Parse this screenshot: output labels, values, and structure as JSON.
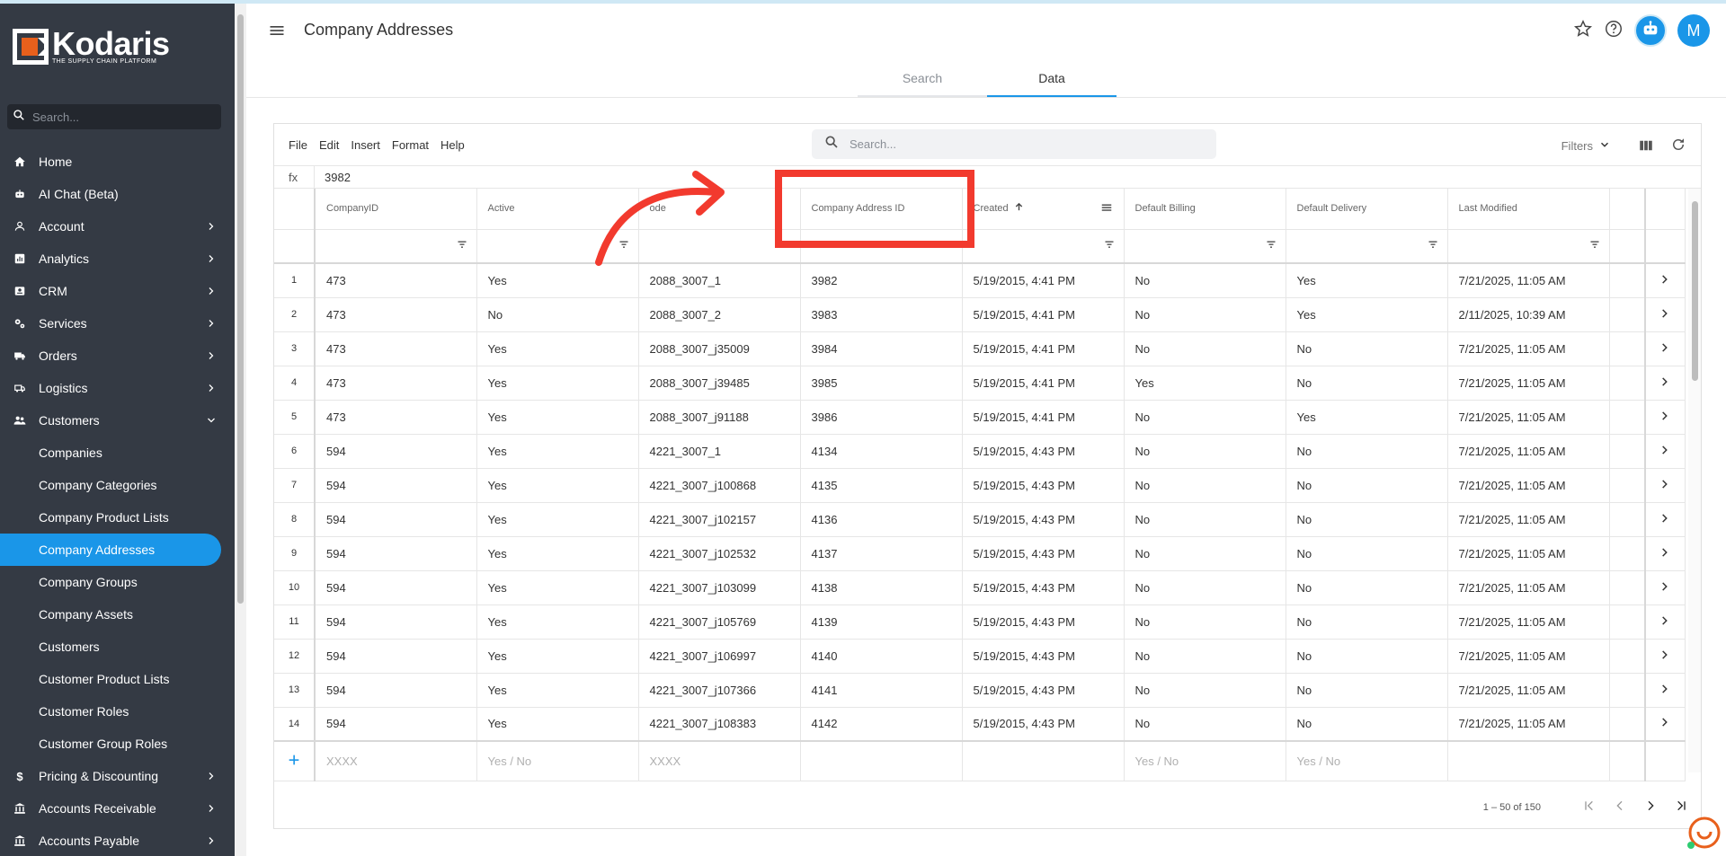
{
  "app": {
    "logo_name": "Kodaris",
    "logo_tagline": "THE SUPPLY CHAIN PLATFORM"
  },
  "sidebar": {
    "search_placeholder": "Search...",
    "items": [
      {
        "label": "Home",
        "icon": "home-icon",
        "expandable": false,
        "sub": false
      },
      {
        "label": "AI Chat (Beta)",
        "icon": "robot-icon",
        "expandable": false,
        "sub": false
      },
      {
        "label": "Account",
        "icon": "person-icon",
        "expandable": true,
        "sub": false
      },
      {
        "label": "Analytics",
        "icon": "chart-icon",
        "expandable": true,
        "sub": false
      },
      {
        "label": "CRM",
        "icon": "contact-icon",
        "expandable": true,
        "sub": false
      },
      {
        "label": "Services",
        "icon": "gears-icon",
        "expandable": true,
        "sub": false
      },
      {
        "label": "Orders",
        "icon": "truck-icon",
        "expandable": true,
        "sub": false
      },
      {
        "label": "Logistics",
        "icon": "shipping-icon",
        "expandable": true,
        "sub": false
      },
      {
        "label": "Customers",
        "icon": "people-icon",
        "expandable": true,
        "expanded": true,
        "sub": false
      },
      {
        "label": "Companies",
        "sub": true
      },
      {
        "label": "Company Categories",
        "sub": true
      },
      {
        "label": "Company Product Lists",
        "sub": true
      },
      {
        "label": "Company Addresses",
        "sub": true,
        "active": true
      },
      {
        "label": "Company Groups",
        "sub": true
      },
      {
        "label": "Company Assets",
        "sub": true
      },
      {
        "label": "Customers",
        "sub": true
      },
      {
        "label": "Customer Product Lists",
        "sub": true
      },
      {
        "label": "Customer Roles",
        "sub": true
      },
      {
        "label": "Customer Group Roles",
        "sub": true
      },
      {
        "label": "Pricing & Discounting",
        "icon": "dollar-icon",
        "expandable": true,
        "sub": false
      },
      {
        "label": "Accounts Receivable",
        "icon": "bank-icon",
        "expandable": true,
        "sub": false
      },
      {
        "label": "Accounts Payable",
        "icon": "bank-icon",
        "expandable": true,
        "sub": false
      }
    ]
  },
  "header": {
    "title": "Company Addresses",
    "avatar_initial": "M",
    "tabs": [
      {
        "label": "Search",
        "active": false
      },
      {
        "label": "Data",
        "active": true
      }
    ]
  },
  "toolbar": {
    "menus": [
      "File",
      "Edit",
      "Insert",
      "Format",
      "Help"
    ],
    "search_placeholder": "Search...",
    "filters_label": "Filters"
  },
  "formula_bar": {
    "label": "fx",
    "value": "3982"
  },
  "grid": {
    "columns": [
      "CompanyID",
      "Active",
      "Code",
      "Company Address ID",
      "Created",
      "Default Billing",
      "Default Delivery",
      "Last Modified"
    ],
    "visible_header_code": "ode",
    "sorted_column": "Created",
    "rows": [
      [
        "1",
        "473",
        "Yes",
        "2088_3007_1",
        "3982",
        "5/19/2015, 4:41 PM",
        "No",
        "Yes",
        "7/21/2025, 11:05 AM"
      ],
      [
        "2",
        "473",
        "No",
        "2088_3007_2",
        "3983",
        "5/19/2015, 4:41 PM",
        "No",
        "Yes",
        "2/11/2025, 10:39 AM"
      ],
      [
        "3",
        "473",
        "Yes",
        "2088_3007_j35009",
        "3984",
        "5/19/2015, 4:41 PM",
        "No",
        "No",
        "7/21/2025, 11:05 AM"
      ],
      [
        "4",
        "473",
        "Yes",
        "2088_3007_j39485",
        "3985",
        "5/19/2015, 4:41 PM",
        "Yes",
        "No",
        "7/21/2025, 11:05 AM"
      ],
      [
        "5",
        "473",
        "Yes",
        "2088_3007_j91188",
        "3986",
        "5/19/2015, 4:41 PM",
        "No",
        "Yes",
        "7/21/2025, 11:05 AM"
      ],
      [
        "6",
        "594",
        "Yes",
        "4221_3007_1",
        "4134",
        "5/19/2015, 4:43 PM",
        "No",
        "No",
        "7/21/2025, 11:05 AM"
      ],
      [
        "7",
        "594",
        "Yes",
        "4221_3007_j100868",
        "4135",
        "5/19/2015, 4:43 PM",
        "No",
        "No",
        "7/21/2025, 11:05 AM"
      ],
      [
        "8",
        "594",
        "Yes",
        "4221_3007_j102157",
        "4136",
        "5/19/2015, 4:43 PM",
        "No",
        "No",
        "7/21/2025, 11:05 AM"
      ],
      [
        "9",
        "594",
        "Yes",
        "4221_3007_j102532",
        "4137",
        "5/19/2015, 4:43 PM",
        "No",
        "No",
        "7/21/2025, 11:05 AM"
      ],
      [
        "10",
        "594",
        "Yes",
        "4221_3007_j103099",
        "4138",
        "5/19/2015, 4:43 PM",
        "No",
        "No",
        "7/21/2025, 11:05 AM"
      ],
      [
        "11",
        "594",
        "Yes",
        "4221_3007_j105769",
        "4139",
        "5/19/2015, 4:43 PM",
        "No",
        "No",
        "7/21/2025, 11:05 AM"
      ],
      [
        "12",
        "594",
        "Yes",
        "4221_3007_j106997",
        "4140",
        "5/19/2015, 4:43 PM",
        "No",
        "No",
        "7/21/2025, 11:05 AM"
      ],
      [
        "13",
        "594",
        "Yes",
        "4221_3007_j107366",
        "4141",
        "5/19/2015, 4:43 PM",
        "No",
        "No",
        "7/21/2025, 11:05 AM"
      ],
      [
        "14",
        "594",
        "Yes",
        "4221_3007_j108383",
        "4142",
        "5/19/2015, 4:43 PM",
        "No",
        "No",
        "7/21/2025, 11:05 AM"
      ]
    ],
    "new_row_placeholders": [
      "XXXX",
      "Yes / No",
      "XXXX",
      "",
      "",
      "Yes / No",
      "Yes / No",
      ""
    ]
  },
  "pagination": {
    "range_label": "1 – 50 of 150"
  },
  "colors": {
    "sidebar_bg": "#343a44",
    "accent": "#1a96e8",
    "annotation_red": "#f23a2e",
    "logo_orange": "#e8601c"
  }
}
